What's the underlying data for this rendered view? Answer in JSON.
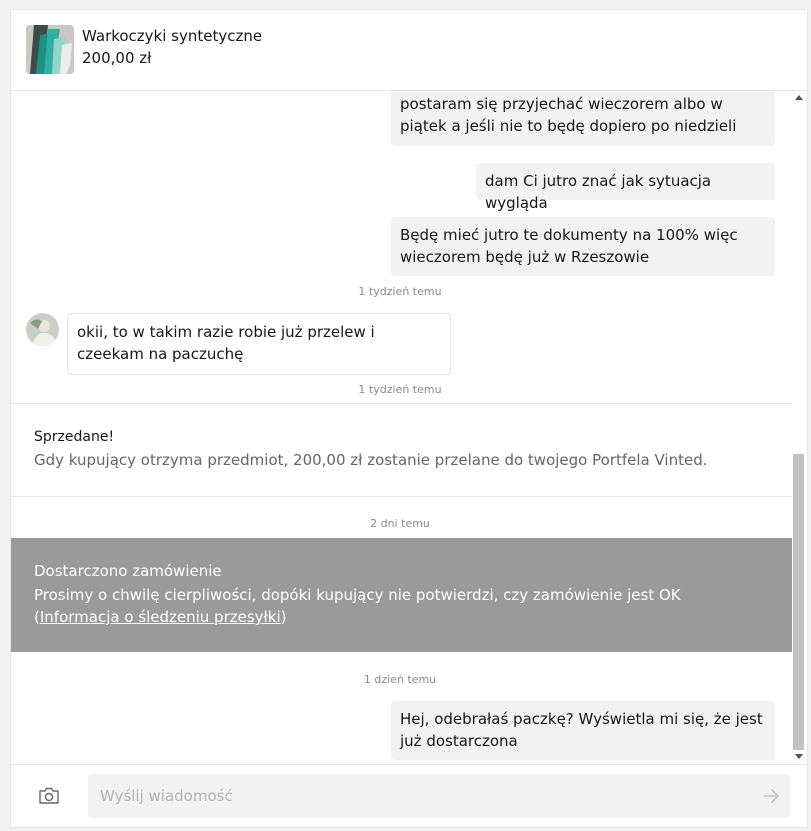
{
  "item": {
    "title": "Warkoczyki syntetyczne",
    "price": "200,00 zł"
  },
  "messages": [
    {
      "text": "postaram się przyjechać wieczorem albo w piątek a jeśli nie to będę dopiero po niedzieli",
      "direction": "out"
    },
    {
      "text": "dam Ci jutro znać jak sytuacja wygląda",
      "direction": "out"
    },
    {
      "text": "Będę mieć jutro te dokumenty na 100% więc wieczorem będę już w Rzeszowie",
      "direction": "out"
    },
    {
      "text": "okii, to w takim razie robie już przelew i czeekam na paczuchę",
      "direction": "in"
    },
    {
      "text": "Hej, odebrałaś paczkę? Wyświetla mi się, że jest już dostarczona",
      "direction": "out"
    }
  ],
  "timestamps": [
    "1 tydzień temu",
    "1 tydzień temu",
    "2 dni temu",
    "1 dzień temu"
  ],
  "sold_notice": {
    "title": "Sprzedane!",
    "description": "Gdy kupujący otrzyma przedmiot, 200,00 zł zostanie przelane do twojego Portfela Vinted."
  },
  "delivered_notice": {
    "title": "Dostarczono zamówienie",
    "description": "Prosimy o chwilę cierpliwości, dopóki kupujący nie potwierdzi, czy zamówienie jest OK",
    "link_prefix": "(",
    "link_text": "Informacja o śledzeniu przesyłki",
    "link_suffix": ")"
  },
  "composer": {
    "placeholder": "Wyślij wiadomość",
    "camera_icon": "camera-icon",
    "send_icon": "send-arrow-icon"
  },
  "colors": {
    "bubble_bg": "#f2f2f3",
    "delivered_bg": "#9a9a9a",
    "muted_text": "#8a8a8a"
  }
}
